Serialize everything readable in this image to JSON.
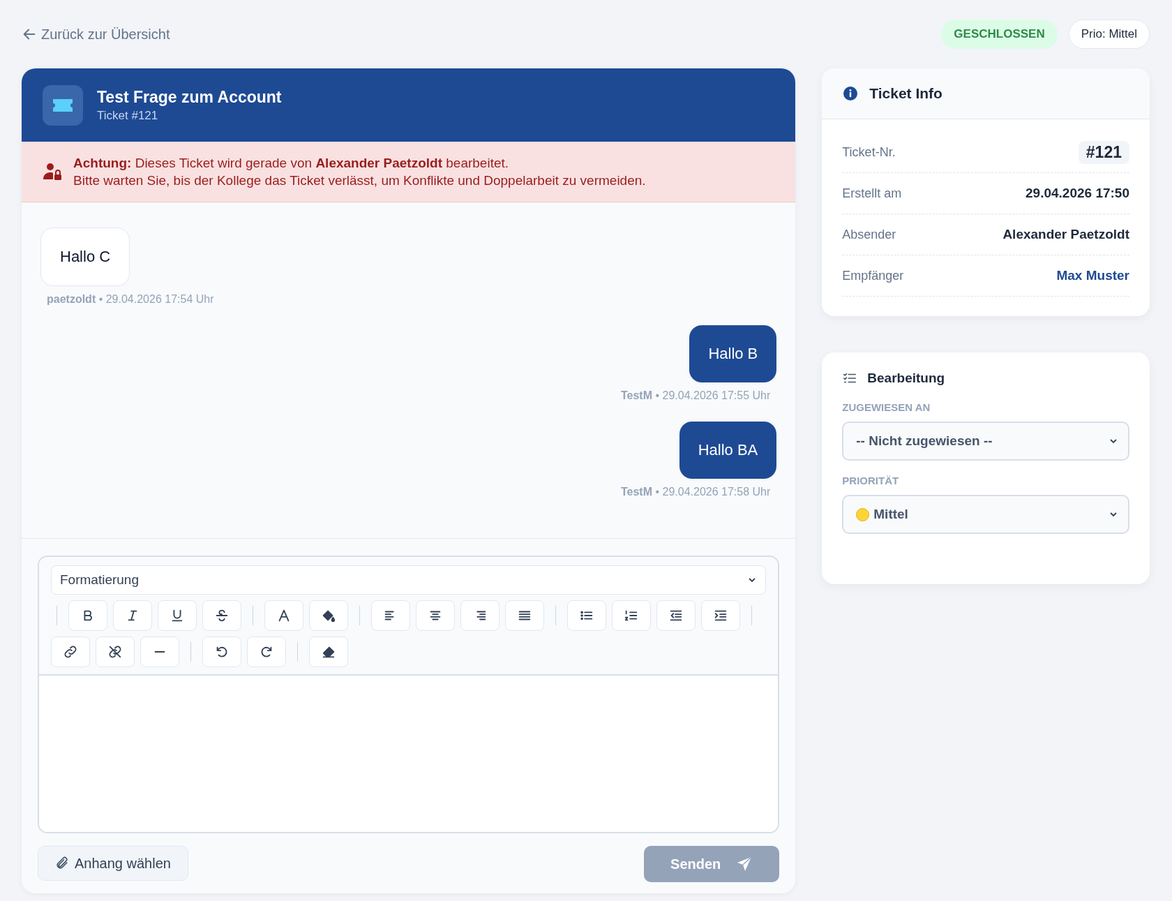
{
  "back_link": "Zurück zur Übersicht",
  "status_badge": "GESCHLOSSEN",
  "priority_badge": "Prio: Mittel",
  "ticket": {
    "title": "Test Frage zum Account",
    "subtitle": "Ticket #121"
  },
  "alert": {
    "lines": [
      "**Achtung:** Dieses Ticket wird gerade von **Alexander Paetzoldt** bearbeitet.",
      "Bitte warten Sie, bis der Kollege das Ticket verlässt, um Konflikte und Doppelarbeit zu vermeiden."
    ]
  },
  "messages": [
    {
      "kind": "incoming",
      "text": "Hallo C",
      "meta": "**paetzoldt** • 29.04.2026 17:54 Uhr"
    },
    {
      "kind": "outgoing",
      "text": "Hallo B",
      "meta": "**TestM** • 29.04.2026 17:55 Uhr"
    },
    {
      "kind": "outgoing",
      "text": "Hallo BA",
      "meta": "**TestM** • 29.04.2026 17:58 Uhr"
    }
  ],
  "editor": {
    "format_select": "Formatierung",
    "attach_button": "Anhang wählen",
    "send_button": {
      "label": "Senden",
      "disabled": true
    }
  },
  "info_card": {
    "title": "Ticket Info",
    "rows": [
      {
        "kind": "badge",
        "label": "Ticket-Nr.",
        "value": "#121"
      },
      {
        "kind": "text",
        "label": "Erstellt am",
        "value": "29.04.2026 17:50"
      },
      {
        "kind": "text",
        "label": "Absender",
        "value": "Alexander Paetzoldt"
      },
      {
        "kind": "link",
        "label": "Empfänger",
        "value": "Max Muster"
      }
    ]
  },
  "edit_card": {
    "title": "Bearbeitung",
    "fields": [
      {
        "label": "ZUGEWIESEN AN",
        "value": "-- Nicht zugewiesen --",
        "dot": false
      },
      {
        "label": "PRIORITÄT",
        "value": "Mittel",
        "dot": true
      }
    ]
  }
}
